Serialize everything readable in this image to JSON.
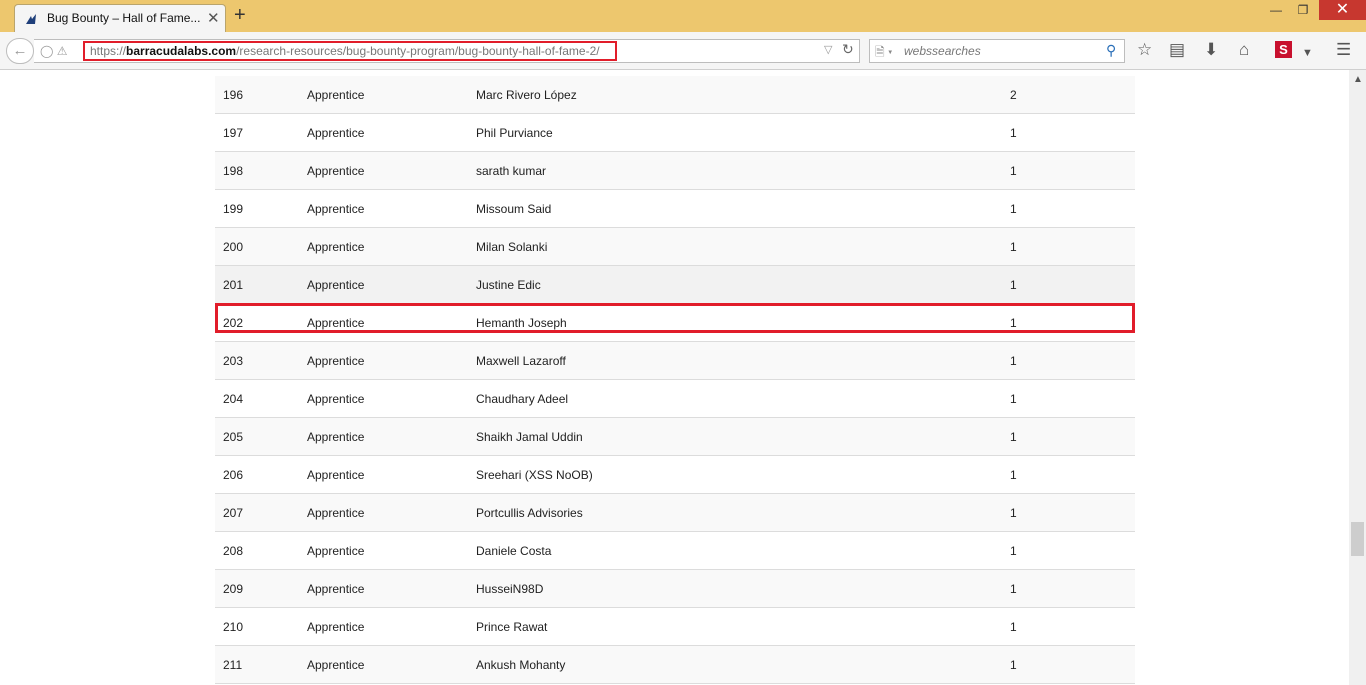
{
  "browser": {
    "tab_title": "Bug Bounty – Hall of Fame...",
    "tab_close": "✕",
    "new_tab": "+",
    "window": {
      "minimize": "—",
      "maximize": "❐",
      "close": "✕"
    },
    "url_prefix": "https://",
    "url_domain": "barracudalabs.com",
    "url_path": "/research-resources/bug-bounty-program/bug-bounty-hall-of-fame-2/",
    "search_placeholder": "webssearches",
    "accent_highlight": "#e11d2a"
  },
  "table": {
    "rows": [
      {
        "rank": "196",
        "level": "Apprentice",
        "name": "Marc Rivero López",
        "count": "2"
      },
      {
        "rank": "197",
        "level": "Apprentice",
        "name": "Phil Purviance",
        "count": "1"
      },
      {
        "rank": "198",
        "level": "Apprentice",
        "name": "sarath kumar",
        "count": "1"
      },
      {
        "rank": "199",
        "level": "Apprentice",
        "name": "Missoum Said",
        "count": "1"
      },
      {
        "rank": "200",
        "level": "Apprentice",
        "name": "Milan Solanki",
        "count": "1"
      },
      {
        "rank": "201",
        "level": "Apprentice",
        "name": "Justine Edic",
        "count": "1"
      },
      {
        "rank": "202",
        "level": "Apprentice",
        "name": "Hemanth Joseph",
        "count": "1"
      },
      {
        "rank": "203",
        "level": "Apprentice",
        "name": "Maxwell Lazaroff",
        "count": "1"
      },
      {
        "rank": "204",
        "level": "Apprentice",
        "name": "Chaudhary Adeel",
        "count": "1"
      },
      {
        "rank": "205",
        "level": "Apprentice",
        "name": "Shaikh Jamal Uddin",
        "count": "1"
      },
      {
        "rank": "206",
        "level": "Apprentice",
        "name": "Sreehari (XSS NoOB)",
        "count": "1"
      },
      {
        "rank": "207",
        "level": "Apprentice",
        "name": "Portcullis Advisories",
        "count": "1"
      },
      {
        "rank": "208",
        "level": "Apprentice",
        "name": "Daniele Costa",
        "count": "1"
      },
      {
        "rank": "209",
        "level": "Apprentice",
        "name": "HusseiN98D",
        "count": "1"
      },
      {
        "rank": "210",
        "level": "Apprentice",
        "name": "Prince Rawat",
        "count": "1"
      },
      {
        "rank": "211",
        "level": "Apprentice",
        "name": "Ankush Mohanty",
        "count": "1"
      }
    ]
  }
}
